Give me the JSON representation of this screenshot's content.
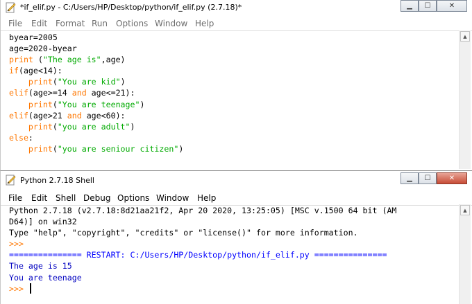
{
  "editor": {
    "title": "*if_elif.py - C:/Users/HP/Desktop/python/if_elif.py (2.7.18)*",
    "menu": [
      "File",
      "Edit",
      "Format",
      "Run",
      "Options",
      "Window",
      "Help"
    ],
    "lines": [
      [
        {
          "t": "byear=2005",
          "c": ""
        }
      ],
      [
        {
          "t": "age=2020-byear",
          "c": ""
        }
      ],
      [
        {
          "t": "print",
          "c": "kw"
        },
        {
          "t": " (",
          "c": ""
        },
        {
          "t": "\"The age is\"",
          "c": "st"
        },
        {
          "t": ",age)",
          "c": ""
        }
      ],
      [
        {
          "t": "if",
          "c": "kw"
        },
        {
          "t": "(age<14):",
          "c": ""
        }
      ],
      [
        {
          "t": "    ",
          "c": ""
        },
        {
          "t": "print",
          "c": "kw"
        },
        {
          "t": "(",
          "c": ""
        },
        {
          "t": "\"You are kid\"",
          "c": "st"
        },
        {
          "t": ")",
          "c": ""
        }
      ],
      [
        {
          "t": "elif",
          "c": "kw"
        },
        {
          "t": "(age>=14 ",
          "c": ""
        },
        {
          "t": "and",
          "c": "kw"
        },
        {
          "t": " age<=21):",
          "c": ""
        }
      ],
      [
        {
          "t": "    ",
          "c": ""
        },
        {
          "t": "print",
          "c": "kw"
        },
        {
          "t": "(",
          "c": ""
        },
        {
          "t": "\"You are teenage\"",
          "c": "st"
        },
        {
          "t": ")",
          "c": ""
        }
      ],
      [
        {
          "t": "elif",
          "c": "kw"
        },
        {
          "t": "(age>21 ",
          "c": ""
        },
        {
          "t": "and",
          "c": "kw"
        },
        {
          "t": " age<60):",
          "c": ""
        }
      ],
      [
        {
          "t": "    ",
          "c": ""
        },
        {
          "t": "print",
          "c": "kw"
        },
        {
          "t": "(",
          "c": ""
        },
        {
          "t": "\"you are adult\"",
          "c": "st"
        },
        {
          "t": ")",
          "c": ""
        }
      ],
      [
        {
          "t": "else",
          "c": "kw"
        },
        {
          "t": ":",
          "c": ""
        }
      ],
      [
        {
          "t": "    ",
          "c": ""
        },
        {
          "t": "print",
          "c": "kw"
        },
        {
          "t": "(",
          "c": ""
        },
        {
          "t": "\"you are seniour citizen\"",
          "c": "st"
        },
        {
          "t": ")",
          "c": ""
        }
      ]
    ]
  },
  "shell": {
    "title": "Python 2.7.18 Shell",
    "menu": [
      "File",
      "Edit",
      "Shell",
      "Debug",
      "Options",
      "Window",
      "Help"
    ],
    "lines": [
      [
        {
          "t": "Python 2.7.18 (v2.7.18:8d21aa21f2, Apr 20 2020, 13:25:05) [MSC v.1500 64 bit (AM",
          "c": ""
        }
      ],
      [
        {
          "t": "D64)] on win32",
          "c": ""
        }
      ],
      [
        {
          "t": "Type \"help\", \"copyright\", \"credits\" or \"license()\" for more information.",
          "c": ""
        }
      ],
      [
        {
          "t": ">>> ",
          "c": "kw"
        }
      ],
      [
        {
          "t": "=============== RESTART: C:/Users/HP/Desktop/python/if_elif.py ===============",
          "c": "bl"
        }
      ],
      [
        {
          "t": "The age is 15",
          "c": "ou"
        }
      ],
      [
        {
          "t": "You are teenage",
          "c": "ou"
        }
      ],
      [
        {
          "t": ">>> ",
          "c": "kw"
        }
      ]
    ]
  },
  "icons": {
    "app": "idle-feather-icon",
    "minimize": "minimize-icon",
    "maximize": "maximize-icon",
    "close": "close-icon",
    "scroll_up": "scroll-up-arrow-icon"
  },
  "colors": {
    "keyword": "#ff7700",
    "string": "#00aa00",
    "output": "#0000c0",
    "restart": "#0000ff"
  }
}
